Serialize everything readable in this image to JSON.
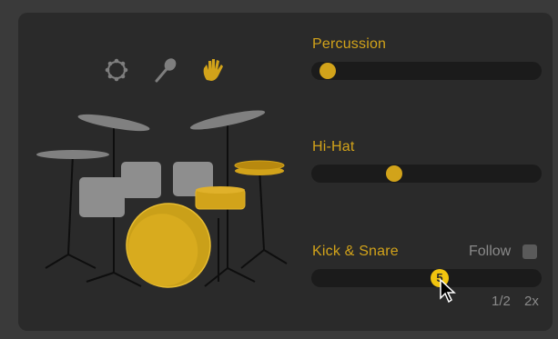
{
  "pattern_icons": [
    {
      "name": "tambourine-icon",
      "active": false
    },
    {
      "name": "shaker-icon",
      "active": false
    },
    {
      "name": "hand-icon",
      "active": true
    }
  ],
  "sliders": {
    "percussion": {
      "label": "Percussion",
      "value": 0.04
    },
    "hihat": {
      "label": "Hi-Hat",
      "value": 0.35
    },
    "kick_snare": {
      "label": "Kick & Snare",
      "value": 0.56
    }
  },
  "follow": {
    "label": "Follow",
    "checked": false
  },
  "badge": {
    "value": "5"
  },
  "rate_options": [
    "1/2",
    "2x"
  ],
  "colors": {
    "accent": "#d2a31a",
    "badge": "#f1c40f",
    "panel": "#2a2a2a",
    "track": "#1b1b1b",
    "inactive": "#8a8a8a"
  }
}
